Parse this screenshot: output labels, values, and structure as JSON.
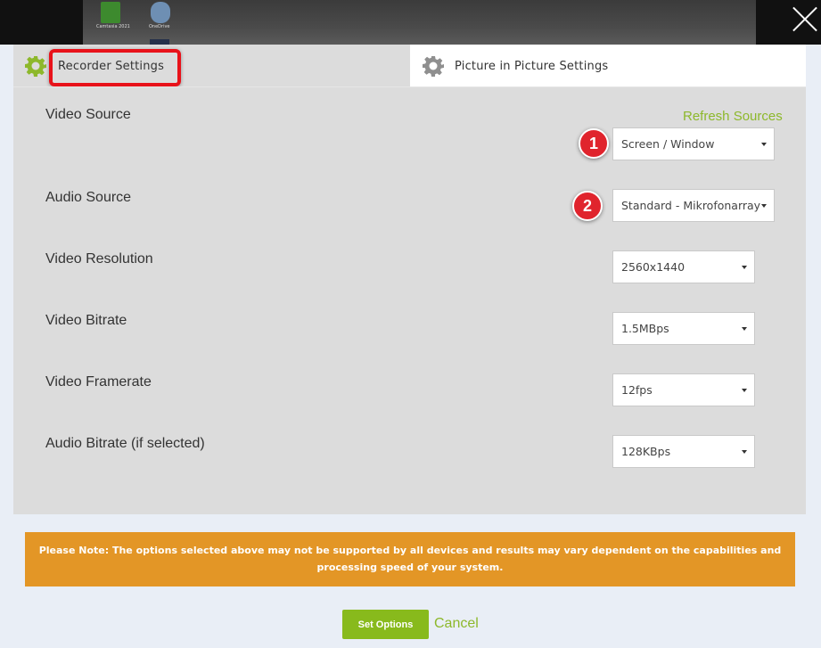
{
  "desktop": {
    "icon1_caption": "Camtasia 2021",
    "icon2_caption": "OneDrive"
  },
  "tabs": [
    {
      "label": "Recorder Settings",
      "active": true
    },
    {
      "label": "Picture in Picture Settings",
      "active": false
    }
  ],
  "settings": {
    "refresh_label": "Refresh Sources",
    "video_source": {
      "label": "Video Source",
      "value": "Screen / Window"
    },
    "audio_source": {
      "label": "Audio Source",
      "value": "Standard - Mikrofonarray"
    },
    "video_resolution": {
      "label": "Video Resolution",
      "value": "2560x1440"
    },
    "video_bitrate": {
      "label": "Video Bitrate",
      "value": "1.5MBps"
    },
    "video_framerate": {
      "label": "Video Framerate",
      "value": "12fps"
    },
    "audio_bitrate": {
      "label": "Audio Bitrate (if selected)",
      "value": "128KBps"
    }
  },
  "annotations": {
    "badge1": "1",
    "badge2": "2"
  },
  "note": "Please Note: The options selected above may not be supported by all devices and results may vary dependent on the capabilities and processing speed of your system.",
  "buttons": {
    "set_options": "Set Options",
    "cancel": "Cancel"
  },
  "colors": {
    "accent_green": "#88ba1c",
    "note_orange": "#e39626",
    "annotation_red": "#e0242d"
  }
}
